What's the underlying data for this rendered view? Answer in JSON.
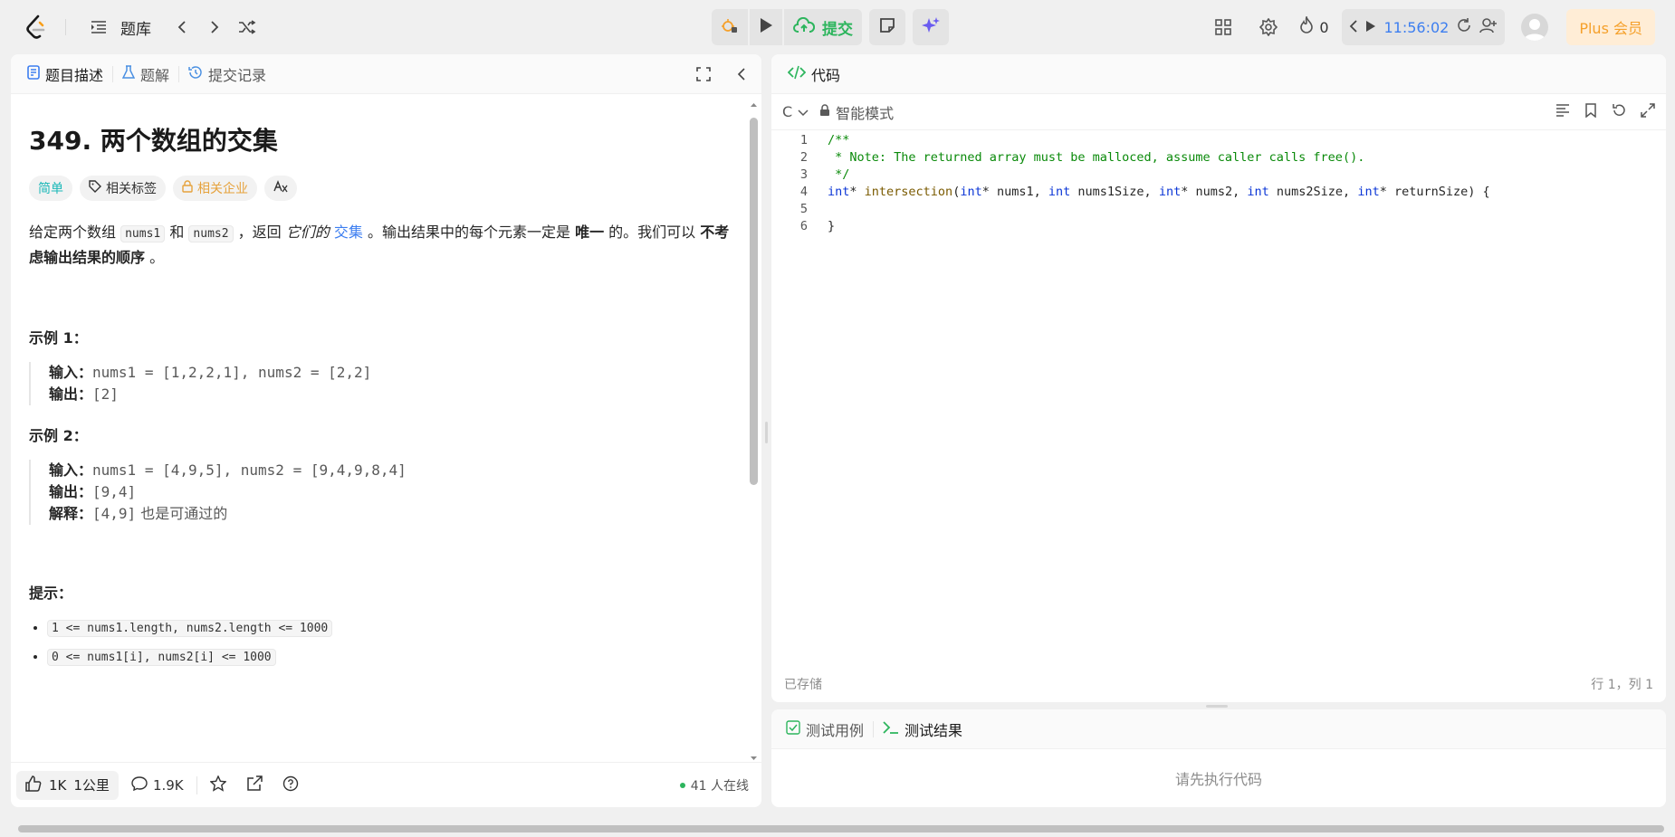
{
  "topbar": {
    "problem_list_label": "题库",
    "submit_label": "提交",
    "streak_count": "0",
    "timer": "11:56:02",
    "plus_label": "Plus 会员"
  },
  "left": {
    "tabs": [
      {
        "label": "题目描述"
      },
      {
        "label": "题解"
      },
      {
        "label": "提交记录"
      }
    ],
    "title": "349. 两个数组的交集",
    "tags": {
      "difficulty": "简单",
      "related": "相关标签",
      "company": "相关企业"
    },
    "desc": {
      "p1": "给定两个数组 ",
      "c1": "nums1",
      "p2": " 和 ",
      "c2": "nums2",
      "p3": " ，返回 ",
      "em": "它们的",
      "link": "交集",
      "p4": " 。输出结果中的每个元素一定是 ",
      "b1": "唯一",
      "p5": " 的。我们可以 ",
      "b2": "不考虑输出结果的顺序",
      "p6": " 。"
    },
    "example1": {
      "title": "示例 1：",
      "input_label": "输入：",
      "input": "nums1 = [1,2,2,1], nums2 = [2,2]",
      "output_label": "输出：",
      "output": "[2]"
    },
    "example2": {
      "title": "示例 2：",
      "input_label": "输入：",
      "input": "nums1 = [4,9,5], nums2 = [9,4,9,8,4]",
      "output_label": "输出：",
      "output": "[9,4]",
      "explain_label": "解释：",
      "explain_code": "[4,9]",
      "explain_text": " 也是可通过的"
    },
    "hints_title": "提示：",
    "hints": [
      "1 <= nums1.length, nums2.length <= 1000",
      "0 <= nums1[i], nums2[i] <= 1000"
    ],
    "footer": {
      "likes": "1K",
      "user": "1公里",
      "comments": "1.9K",
      "online": "41 人在线"
    }
  },
  "code": {
    "tab_label": "代码",
    "language": "C",
    "mode": "智能模式",
    "lines": [
      "1",
      "2",
      "3",
      "4",
      "5",
      "6"
    ],
    "line1": "/**",
    "line2": " * Note: The returned array must be malloced, assume caller calls free().",
    "line3": " */",
    "line6": "}",
    "line4": {
      "t1": "int",
      "t2": "* ",
      "t3": "intersection",
      "t4": "(",
      "t5": "int",
      "t6": "* nums1, ",
      "t7": "int",
      "t8": " nums1Size, ",
      "t9": "int",
      "t10": "* nums2, ",
      "t11": "int",
      "t12": " nums2Size, ",
      "t13": "int",
      "t14": "* returnSize) {"
    },
    "saved": "已存储",
    "cursor": "行 1，列 1"
  },
  "test": {
    "tab1": "测试用例",
    "tab2": "测试结果",
    "empty": "请先执行代码"
  },
  "colors": {
    "accent_green": "#2db55d",
    "link_blue": "#3c7ef0",
    "plus_orange": "#f5a02a"
  }
}
